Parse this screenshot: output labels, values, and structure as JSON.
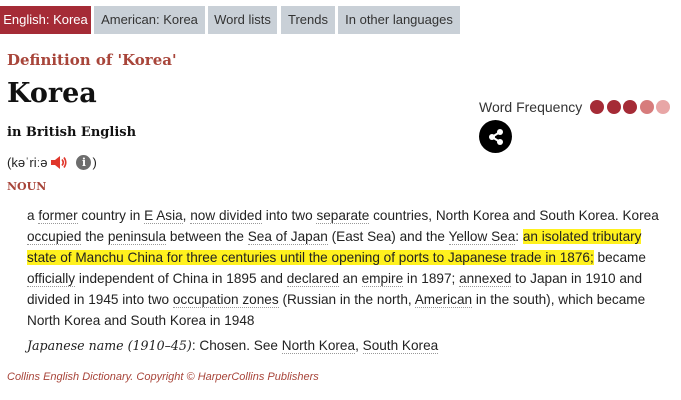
{
  "tabs": [
    {
      "label": "English: Korea",
      "active": true
    },
    {
      "label": "American: Korea",
      "active": false
    },
    {
      "label": "Word lists",
      "active": false
    },
    {
      "label": "Trends",
      "active": false
    },
    {
      "label": "In other languages",
      "active": false
    }
  ],
  "entry": {
    "definition_heading": "Definition of 'Korea'",
    "headword": "Korea",
    "dictionary_label": "in British English",
    "pronunciation": "(kəˈriːə",
    "pronunciation_close": ")",
    "info_symbol": "i",
    "part_of_speech": "NOUN"
  },
  "word_frequency": {
    "label": "Word Frequency",
    "level": "3 of 5",
    "colors": [
      "#a52b36",
      "#a52b36",
      "#a52b36",
      "#d77c7c",
      "#e8a6a6"
    ]
  },
  "definition": {
    "s1": "a ",
    "w_former": "former",
    "s2": " country in ",
    "w_easia": "E Asia",
    "s3": ", ",
    "w_nowdivided": "now divided",
    "s4": " into two ",
    "w_separate": "separate",
    "s5": " countries, North Korea and South Korea. Korea ",
    "w_occupied": "occupied",
    "s6": " the ",
    "w_peninsula": "peninsula",
    "s7": " between the ",
    "w_seaofjapan": "Sea of Japan",
    "s8": " (East Sea) and the ",
    "w_yellowsea": "Yellow Sea",
    "s9": ": ",
    "highlight": "an isolated tributary state of Manchu China for three centuries until the opening of ports to Japanese trade in 1876;",
    "s10": " became ",
    "w_officially": "officially",
    "s11": " independent of China in 1895 and ",
    "w_declared": "declared",
    "s12": " an ",
    "w_empire": "empire",
    "s13": " in 1897; ",
    "w_annexed": "annexed",
    "s14": " to Japan in 1910 and divided in 1945 into two ",
    "w_occupation": "occupation zones",
    "s15": " (Russian in the north, ",
    "w_american": "American",
    "s16": " in the south), which became North Korea and South Korea in 1948"
  },
  "japanese_name": {
    "label": "Japanese name (1910–45)",
    "text": ": Chosen. See ",
    "link1": "North Korea",
    "sep": ", ",
    "link2": "South Korea"
  },
  "copyright": "Collins English Dictionary. Copyright © HarperCollins Publishers"
}
